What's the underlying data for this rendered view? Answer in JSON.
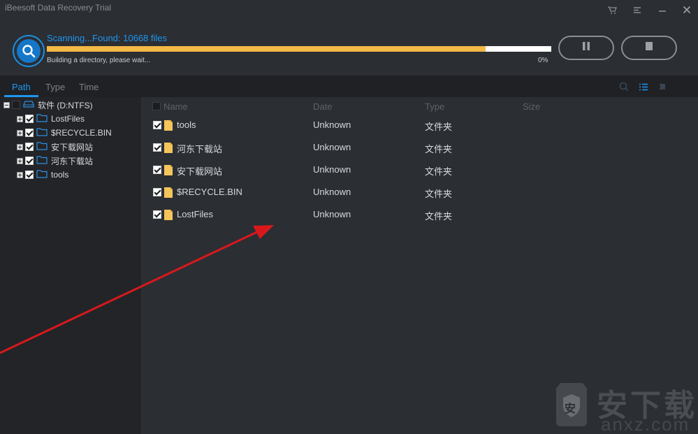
{
  "window": {
    "title": "iBeesoft Data Recovery Trial",
    "controls": [
      "cart-icon",
      "menu-icon",
      "minimize-icon",
      "close-icon"
    ]
  },
  "scan": {
    "status": "Scanning...Found: 10668 files",
    "substatus": "Building a directory, please wait...",
    "percent_label": "0%",
    "progress_fraction": 0.87,
    "progress_color": "#f4b847",
    "accent": "#1e96f0"
  },
  "controls": {
    "pause_icon": "pause-icon",
    "stop_icon": "stop-icon"
  },
  "tabs": [
    {
      "label": "Path",
      "active": true
    },
    {
      "label": "Type",
      "active": false
    },
    {
      "label": "Time",
      "active": false
    }
  ],
  "view_icons": [
    "search-icon",
    "list-view-icon",
    "grid-view-icon"
  ],
  "tree": {
    "root": {
      "label": "软件 (D:NTFS)",
      "checked": false
    },
    "children": [
      {
        "label": "LostFiles",
        "checked": true
      },
      {
        "label": "$RECYCLE.BIN",
        "checked": true
      },
      {
        "label": "安下载网站",
        "checked": true
      },
      {
        "label": "河东下载站",
        "checked": true
      },
      {
        "label": "tools",
        "checked": true
      }
    ]
  },
  "list": {
    "columns": [
      "Name",
      "Date",
      "Type",
      "Size"
    ],
    "rows": [
      {
        "name": "tools",
        "date": "Unknown",
        "type": "文件夹",
        "size": ""
      },
      {
        "name": "河东下载站",
        "date": "Unknown",
        "type": "文件夹",
        "size": ""
      },
      {
        "name": "安下载网站",
        "date": "Unknown",
        "type": "文件夹",
        "size": ""
      },
      {
        "name": "$RECYCLE.BIN",
        "date": "Unknown",
        "type": "文件夹",
        "size": ""
      },
      {
        "name": "LostFiles",
        "date": "Unknown",
        "type": "文件夹",
        "size": ""
      }
    ]
  },
  "watermark": {
    "logo_char": "安",
    "text": "安下载",
    "url": "anxz.com"
  }
}
